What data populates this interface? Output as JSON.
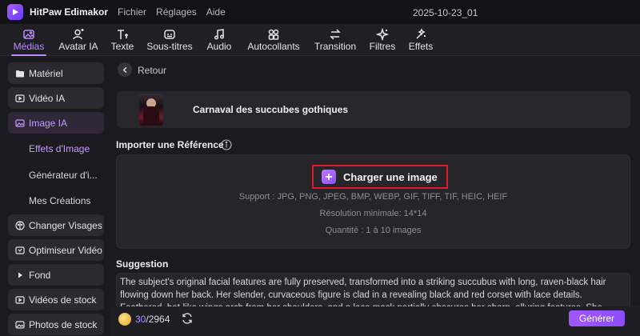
{
  "app": {
    "name": "HitPaw Edimakor",
    "menu": [
      "Fichier",
      "Réglages",
      "Aide"
    ],
    "project_title": "2025-10-23_01"
  },
  "toolbar": {
    "items": [
      {
        "label": "Médias",
        "icon": "image-icon",
        "active": true
      },
      {
        "label": "Avatar IA",
        "icon": "avatar-icon",
        "active": false
      },
      {
        "label": "Texte",
        "icon": "text-icon",
        "active": false
      },
      {
        "label": "Sous-titres",
        "icon": "subtitles-icon",
        "active": false
      },
      {
        "label": "Audio",
        "icon": "music-icon",
        "active": false
      },
      {
        "label": "Autocollants",
        "icon": "sticker-icon",
        "active": false
      },
      {
        "label": "Transition",
        "icon": "transition-icon",
        "active": false
      },
      {
        "label": "Filtres",
        "icon": "filter-icon",
        "active": false
      },
      {
        "label": "Effets",
        "icon": "effects-icon",
        "active": false
      }
    ],
    "accent_color": "#b98cff"
  },
  "sidebar": {
    "items": [
      {
        "label": "Matériel",
        "icon": "folder-icon"
      },
      {
        "label": "Vidéo IA",
        "icon": "video-ai-icon"
      },
      {
        "label": "Image IA",
        "icon": "image-ai-icon",
        "active": true
      },
      {
        "label": "Changer Visages",
        "icon": "face-swap-icon"
      },
      {
        "label": "Optimiseur Vidéo",
        "icon": "video-enhance-icon"
      },
      {
        "label": "Fond",
        "icon": "play-triangle-icon"
      },
      {
        "label": "Vidéos de stock",
        "icon": "stock-video-icon"
      },
      {
        "label": "Photos de stock",
        "icon": "stock-photo-icon"
      }
    ],
    "subitems": [
      {
        "label": "Effets d'Image",
        "active": true
      },
      {
        "label": "Générateur d'i..."
      },
      {
        "label": "Mes Créations"
      }
    ]
  },
  "main": {
    "back_label": "Retour",
    "effect_name": "Carnaval des succubes gothiques",
    "reference_label": "Importer une Référence",
    "upload": {
      "button_label": "Charger une image",
      "support": "Support : JPG, PNG, JPEG, BMP, WEBP, GIF, TIFF, TIF, HEIC, HEIF",
      "min_resolution": "Résolution minimale: 14*14",
      "quantity": "Quantité : 1 à 10 images",
      "highlight_color": "#e0192f"
    },
    "suggestion_label": "Suggestion",
    "suggestion_text": "The subject's original facial features are fully preserved, transformed into a striking succubus with long, raven-black hair flowing down her back. Her slender, curvaceous figure is clad in a revealing black and red corset with lace details. Feathered, bat-like wings arch from her shoulders, and a lace mask partially obscures her sharp, alluring features. She stands confidently before a"
  },
  "footer": {
    "credits_used": "30",
    "credits_total": "/2964",
    "generate_label": "Générer"
  }
}
